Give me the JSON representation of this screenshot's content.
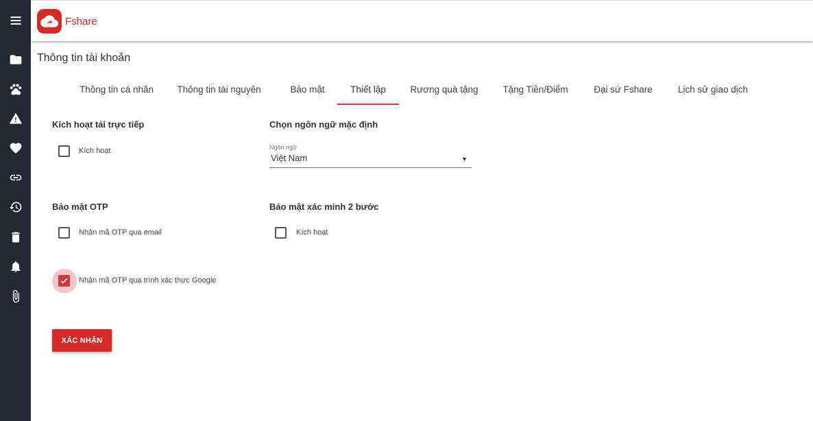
{
  "app": {
    "brand": "Fshare",
    "logo_icon": "cloud-upload-icon",
    "brand_color": "#d42b28"
  },
  "sidebar": {
    "items": [
      {
        "icon": "menu-icon"
      },
      {
        "icon": "folder-icon"
      },
      {
        "icon": "paw-icon"
      },
      {
        "icon": "warning-icon"
      },
      {
        "icon": "heart-icon"
      },
      {
        "icon": "link-icon"
      },
      {
        "icon": "history-icon"
      },
      {
        "icon": "trash-icon"
      },
      {
        "icon": "bell-icon"
      },
      {
        "icon": "paperclip-icon"
      }
    ]
  },
  "page": {
    "title": "Thông tin tài khoản"
  },
  "tabs": [
    {
      "label": "Thông tin cá nhân",
      "active": false
    },
    {
      "label": "Thông tin tài nguyên",
      "active": false
    },
    {
      "label": "Bảo mật",
      "active": false
    },
    {
      "label": "Thiết lập",
      "active": true
    },
    {
      "label": "Rương quà tặng",
      "active": false
    },
    {
      "label": "Tặng Tiền/Điểm",
      "active": false
    },
    {
      "label": "Đại sứ Fshare",
      "active": false
    },
    {
      "label": "Lịch sử giao dịch",
      "active": false
    }
  ],
  "direct_download": {
    "title": "Kích hoạt tải trực tiếp",
    "checkbox_label": "Kích hoạt",
    "checked": false
  },
  "language": {
    "title": "Chọn ngôn ngữ mặc định",
    "field_label": "Ngôn ngữ",
    "value": "Việt Nam"
  },
  "otp": {
    "title": "Bảo mật OTP",
    "email_label": "Nhận mã OTP qua email",
    "email_checked": false,
    "google_label": "Nhận mã OTP qua trình xác thực Google",
    "google_checked": true
  },
  "two_step": {
    "title": "Bảo mật xác minh 2 bước",
    "checkbox_label": "Kích hoạt",
    "checked": false
  },
  "actions": {
    "confirm_label": "XÁC NHẬN"
  },
  "colors": {
    "accent": "#d4373b",
    "sidebar_bg": "#232833"
  }
}
